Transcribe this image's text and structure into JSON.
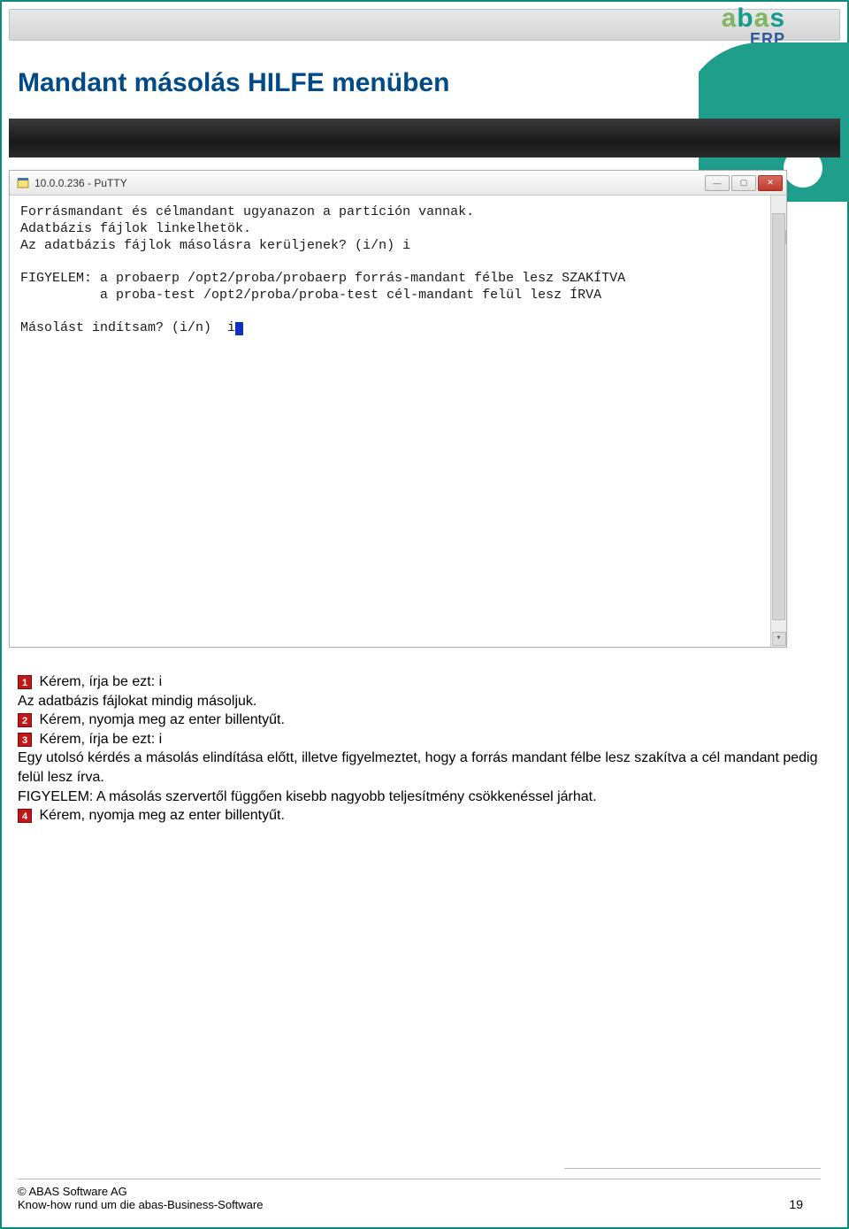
{
  "logo": {
    "text_abas": "abas",
    "text_erp": "ERP"
  },
  "slide_title": "Mandant másolás HILFE menüben",
  "putty": {
    "title": "10.0.0.236 - PuTTY",
    "minimize": "—",
    "maximize": "▢",
    "close": "✕",
    "scroll_up": "▴",
    "scroll_down": "▾",
    "lines": {
      "l1": "Forrásmandant és célmandant ugyanazon a partíción vannak.",
      "l2": "Adatbázis fájlok linkelhetök.",
      "l3": "Az adatbázis fájlok másolásra kerüljenek? (i/n) i",
      "l4": "",
      "l5": "FIGYELEM: a probaerp /opt2/proba/probaerp forrás-mandant félbe lesz SZAKÍTVA",
      "l6": "          a proba-test /opt2/proba/proba-test cél-mandant felül lesz ÍRVA",
      "l7": "",
      "l8": "Másolást indítsam? (i/n)  i"
    }
  },
  "badges": {
    "b1": "1",
    "b2": "2",
    "b3": "3",
    "b4": "4"
  },
  "instr": {
    "p1a": " Kérem, írja be ezt: i",
    "p1b": "Az adatbázis fájlokat mindig másoljuk.",
    "p2": " Kérem, nyomja meg az enter billentyűt.",
    "p3a": " Kérem, írja be ezt: i",
    "p3b": "Egy utolsó kérdés a másolás elindítása előtt, illetve figyelmeztet, hogy a forrás mandant félbe lesz szakítva a cél mandant pedig felül lesz írva.",
    "p3c": "FIGYELEM: A másolás szervertől függően kisebb nagyobb teljesítmény csökkenéssel járhat.",
    "p4": " Kérem, nyomja meg az enter billentyűt."
  },
  "footer": {
    "copyright": "© ABAS Software AG",
    "tagline": "Know-how rund um die abas-Business-Software",
    "page": "19"
  }
}
